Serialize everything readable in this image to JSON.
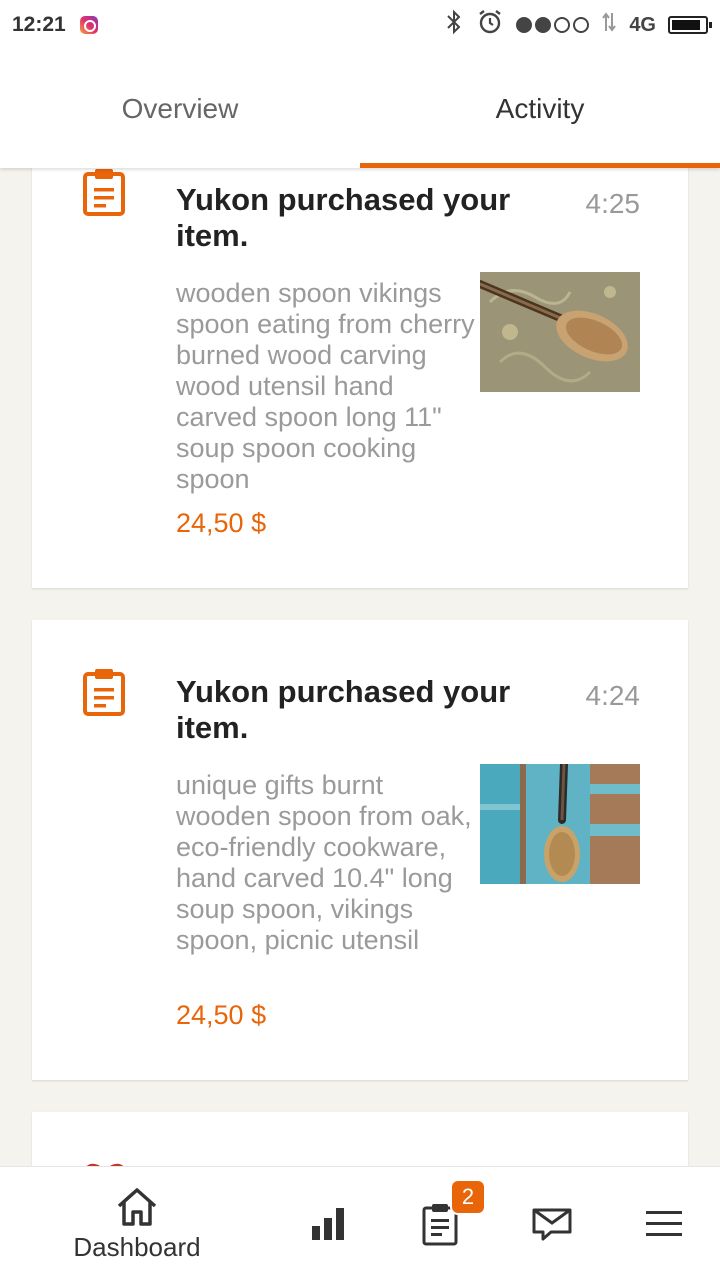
{
  "status_bar": {
    "time": "12:21",
    "network": "4G",
    "icons": [
      "instagram-icon",
      "bluetooth-icon",
      "alarm-icon",
      "signal-icon",
      "battery-icon"
    ]
  },
  "tabs": [
    {
      "label": "Overview",
      "active": false
    },
    {
      "label": "Activity",
      "active": true
    }
  ],
  "activity": [
    {
      "icon": "clipboard-icon",
      "title": "Yukon purchased your item.",
      "time": "4:25",
      "description": "wooden spoon vikings spoon eating from cherry burned wood carving wood utensil hand carved spoon long 11\" soup spoon cooking spoon",
      "price": "24,50 $"
    },
    {
      "icon": "clipboard-icon",
      "title": "Yukon purchased your item.",
      "time": "4:24",
      "description": "unique gifts burnt wooden spoon from oak, eco-friendly cookware, hand carved 10.4\" long soup spoon, vikings spoon, picnic utensil",
      "price": "24,50 $"
    }
  ],
  "bottom_nav": {
    "dashboard_label": "Dashboard",
    "orders_badge": "2",
    "icons": [
      "home-icon",
      "stats-icon",
      "orders-icon",
      "mail-icon",
      "menu-icon"
    ]
  },
  "colors": {
    "accent": "#e8650a",
    "background": "#f5f3ee",
    "heart": "#c0392b"
  }
}
